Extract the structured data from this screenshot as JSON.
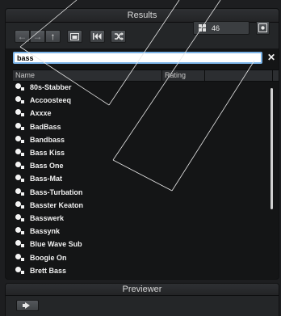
{
  "results_panel": {
    "title": "Results"
  },
  "toolbar": {
    "back_icon": "back-arrow-icon",
    "forward_icon": "forward-arrow-icon",
    "up_icon": "up-arrow-icon",
    "folder_icon": "folder-icon",
    "skip_back_icon": "skip-back-icon",
    "shuffle_icon": "shuffle-icon",
    "settings_icon": "settings-icon",
    "result_count": "46"
  },
  "search": {
    "value": "bass"
  },
  "columns": {
    "name": "Name",
    "rating": "Rating",
    "extra": ""
  },
  "presets": [
    "80s-Stabber",
    "Accoosteeq",
    "Axxxe",
    "BadBass",
    "Bandbass",
    "Bass Kiss",
    "Bass One",
    "Bass-Mat",
    "Bass-Turbation",
    "Basster Keaton",
    "Basswerk",
    "Bassynk",
    "Blue Wave Sub",
    "Boogie On",
    "Brett Bass"
  ],
  "previewer": {
    "title": "Previewer"
  },
  "colors": {
    "background": "#1d1e20",
    "search_focus": "#7ab3e8",
    "text": "#f0f0f0"
  }
}
